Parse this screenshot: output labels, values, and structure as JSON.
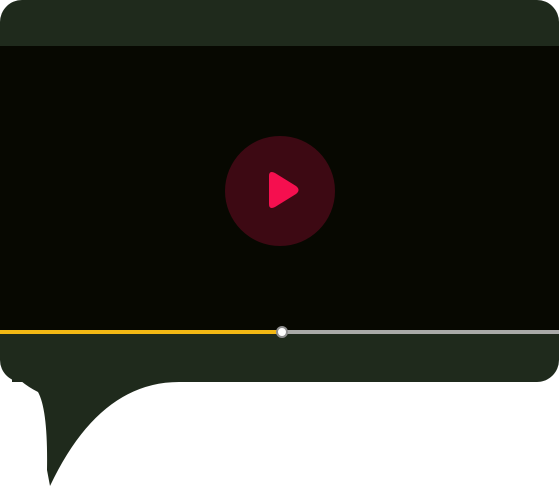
{
  "player": {
    "progress_fraction": 0.505,
    "colors": {
      "frame": "#1f2a1c",
      "video_background": "#070801",
      "play_circle": "#3d0913",
      "play_icon": "#f50f4f",
      "progress_played": "#f2b814",
      "progress_remaining": "#a9aaa8",
      "thumb": "#ffffff"
    },
    "icons": {
      "play": "play-icon"
    }
  }
}
